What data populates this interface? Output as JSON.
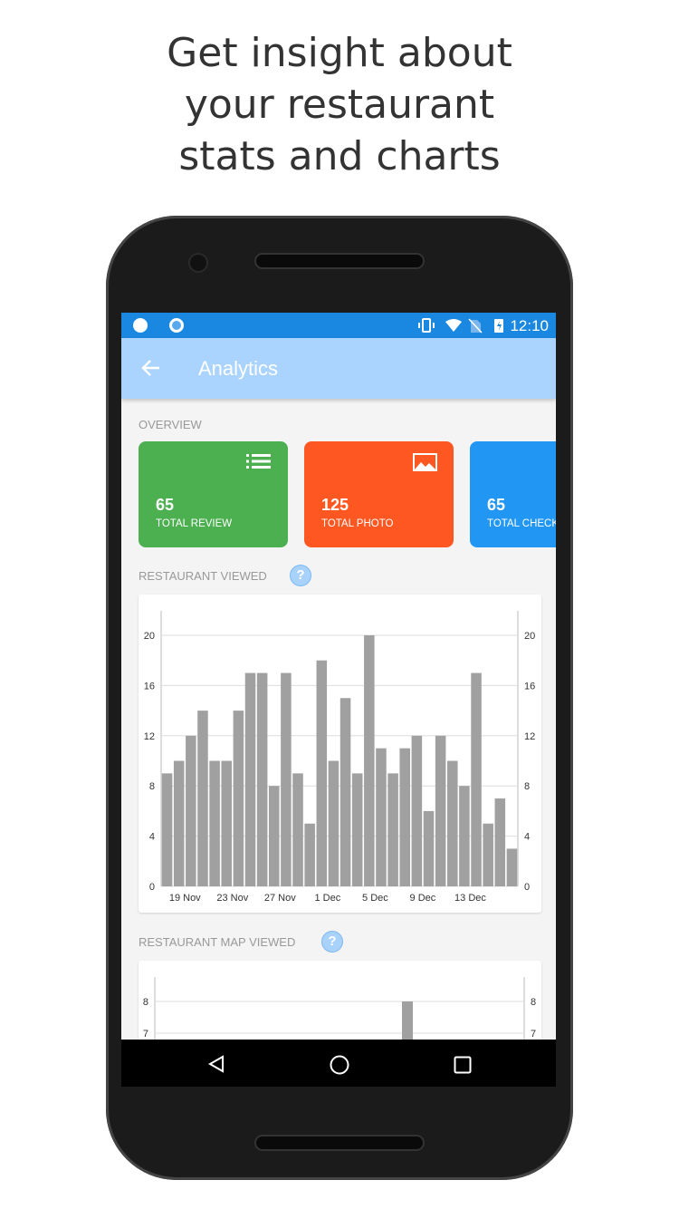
{
  "headline": [
    "Get insight about",
    "your restaurant",
    "stats and charts"
  ],
  "status_bar": {
    "time": "12:10",
    "icons": [
      "firefox-icon",
      "circle-notification-icon",
      "vibrate-icon",
      "wifi-icon",
      "no-sim-icon",
      "battery-charging-icon"
    ],
    "color": "#1a88e0"
  },
  "app_bar": {
    "title": "Analytics",
    "back_icon": "arrow-left-icon",
    "color": "#aad4fd"
  },
  "overview": {
    "label": "OVERVIEW",
    "cards": [
      {
        "value": "65",
        "label": "TOTAL REVIEW",
        "icon": "list-icon",
        "color": "#4caf50"
      },
      {
        "value": "125",
        "label": "TOTAL PHOTO",
        "icon": "image-icon",
        "color": "#ff5722"
      },
      {
        "value": "65",
        "label": "TOTAL CHECK",
        "icon": "",
        "color": "#2196f3"
      }
    ]
  },
  "sections": {
    "viewed": "RESTAURANT VIEWED",
    "map_viewed": "RESTAURANT MAP VIEWED",
    "help": "?"
  },
  "chart_data": [
    {
      "type": "bar",
      "title": "",
      "xlabel": "",
      "ylabel": "",
      "ylim": [
        0,
        20
      ],
      "grid": true,
      "y_ticks": [
        "0",
        "4",
        "8",
        "12",
        "16",
        "20"
      ],
      "x_tick_labels": [
        "19 Nov",
        "23 Nov",
        "27 Nov",
        "1 Dec",
        "5 Dec",
        "9 Dec",
        "13 Dec"
      ],
      "values": [
        9,
        10,
        12,
        14,
        10,
        10,
        14,
        17,
        17,
        8,
        17,
        9,
        5,
        18,
        10,
        15,
        9,
        20,
        11,
        9,
        11,
        12,
        6,
        12,
        10,
        8,
        17,
        5,
        7,
        3
      ],
      "bar_color": "#a0a0a0"
    },
    {
      "type": "bar",
      "title": "",
      "grid": true,
      "y_ticks_visible": [
        "7",
        "8"
      ],
      "visible_bar_values": [
        8
      ],
      "bar_color": "#a0a0a0"
    }
  ],
  "nav_bar": {
    "icons": [
      "back-triangle-icon",
      "home-circle-icon",
      "recents-square-icon"
    ]
  }
}
